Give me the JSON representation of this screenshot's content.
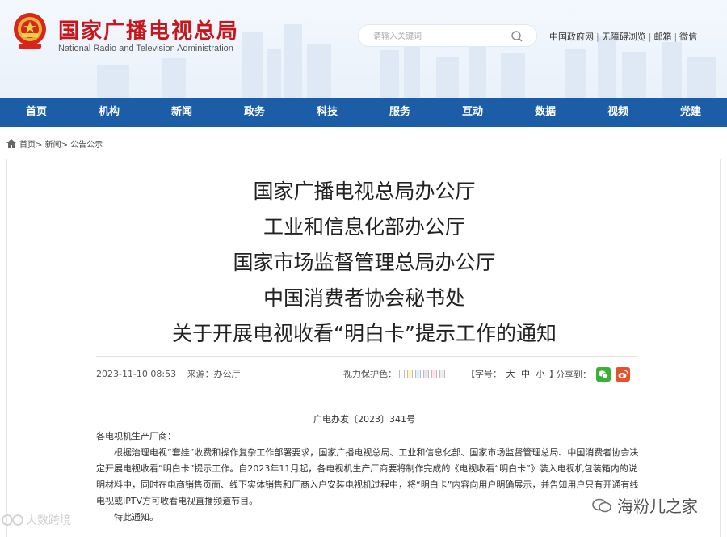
{
  "header": {
    "title": "国家广播电视总局",
    "subtitle": "National Radio and Television Administration",
    "search_placeholder": "请输入关键词",
    "top_links": [
      "中国政府网",
      "无障碍浏览",
      "邮箱",
      "微信"
    ],
    "top_link_sep": "|"
  },
  "nav": {
    "items": [
      "首页",
      "机构",
      "新闻",
      "政务",
      "科技",
      "服务",
      "互动",
      "数据",
      "视频",
      "党建"
    ]
  },
  "breadcrumb": {
    "items": [
      "首页>",
      "新闻>",
      "公告公示"
    ]
  },
  "article": {
    "title_lines": [
      "国家广播电视总局办公厅",
      "工业和信息化部办公厅",
      "国家市场监督管理总局办公厅",
      "中国消费者协会秘书处",
      "关于开展电视收看“明白卡”提示工作的通知"
    ],
    "datetime": "2023-11-10 08:53",
    "source": "来源：办公厅",
    "vision_label": "视力保护色：",
    "vision_colors": [
      "#ffffff",
      "#fff6c5",
      "#dff0ff",
      "#e8e4f5",
      "#fde4ea",
      "#eeeeee"
    ],
    "fontsize_label": "【字号：",
    "fontsize_options": [
      "大",
      "中",
      "小"
    ],
    "fontsize_close": "】",
    "share_label": "分享到：",
    "doc_number": "广电办发〔2023〕341号",
    "salutation": "各电视机生产厂商：",
    "paragraph": "根据治理电视“套娃”收费和操作复杂工作部署要求，国家广播电视总局、工业和信息化部、国家市场监督管理总局、中国消费者协会决定开展电视收看“明白卡”提示工作。自2023年11月起，各电视机生产厂商要将制作完成的《电视收看“明白卡”》装入电视机包装箱内的说明材料中，同时在电商销售页面、线下实体销售和厂商入户安装电视机过程中，将“明白卡”内容向用户明确展示，并告知用户只有开通有线电视或IPTV方可收看电视直播频道节目。",
    "closing": "特此通知。"
  },
  "watermarks": {
    "left": "大数跨境",
    "right": "海粉儿之家"
  },
  "colors": {
    "brand_red": "#c8161d",
    "nav_blue": "#1b5da6",
    "wechat_green": "#3cb034",
    "weibo_red": "#e6512c"
  }
}
